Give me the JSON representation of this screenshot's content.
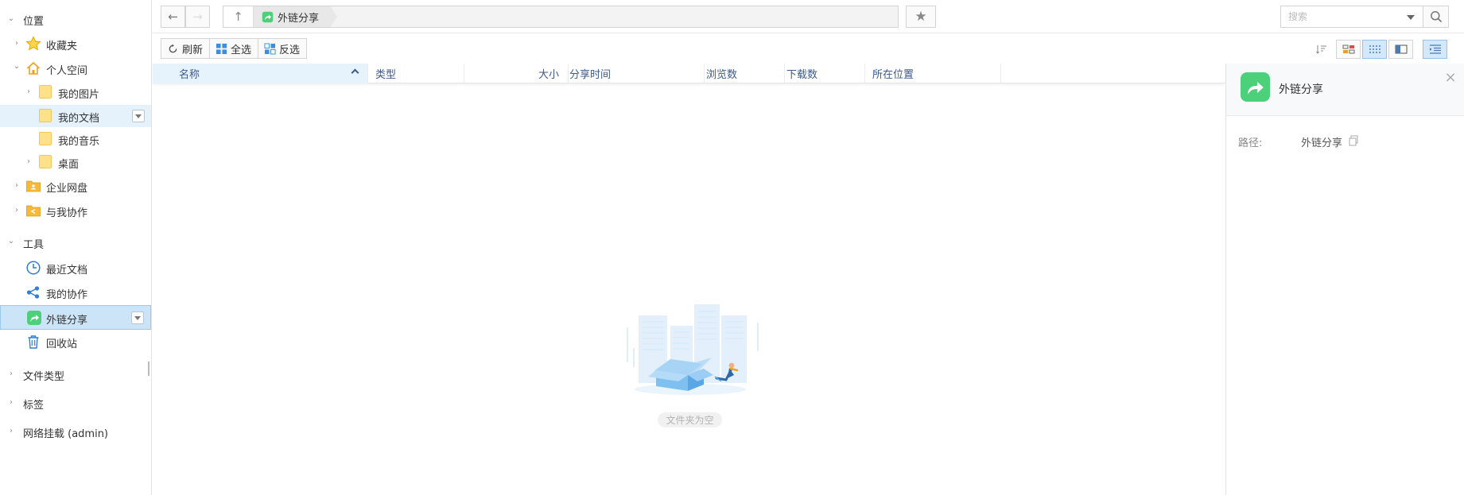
{
  "sidebar": {
    "sections": [
      {
        "label": "位置"
      },
      {
        "label": "工具"
      },
      {
        "label": "文件类型"
      },
      {
        "label": "标签"
      },
      {
        "label": "网络挂载 (admin)"
      }
    ],
    "location_items": [
      {
        "label": "收藏夹",
        "icon": "star-icon"
      },
      {
        "label": "个人空间",
        "icon": "home-icon"
      },
      {
        "label": "我的图片",
        "icon": "folder-icon"
      },
      {
        "label": "我的文档",
        "icon": "folder-icon"
      },
      {
        "label": "我的音乐",
        "icon": "folder-icon"
      },
      {
        "label": "桌面",
        "icon": "folder-icon"
      },
      {
        "label": "企业网盘",
        "icon": "enterprise-folder-icon"
      },
      {
        "label": "与我协作",
        "icon": "shared-folder-icon"
      }
    ],
    "tool_items": [
      {
        "label": "最近文档",
        "icon": "clock-icon"
      },
      {
        "label": "我的协作",
        "icon": "share-nodes-icon"
      },
      {
        "label": "外链分享",
        "icon": "share-link-icon"
      },
      {
        "label": "回收站",
        "icon": "trash-icon"
      }
    ]
  },
  "address": {
    "crumb": "外链分享"
  },
  "search": {
    "placeholder": "搜索"
  },
  "toolbar": {
    "refresh": "刷新",
    "select_all": "全选",
    "invert": "反选"
  },
  "list": {
    "columns": [
      "名称",
      "类型",
      "大小",
      "分享时间",
      "浏览数",
      "下载数",
      "所在位置"
    ],
    "sorted_column": "名称",
    "empty_text": "文件夹为空"
  },
  "panel": {
    "title": "外链分享",
    "path_label": "路径:",
    "path_value": "外链分享"
  },
  "colors": {
    "accent": "#4cd07a",
    "selection": "#cce4f7",
    "header_text": "#3d5a8a"
  }
}
